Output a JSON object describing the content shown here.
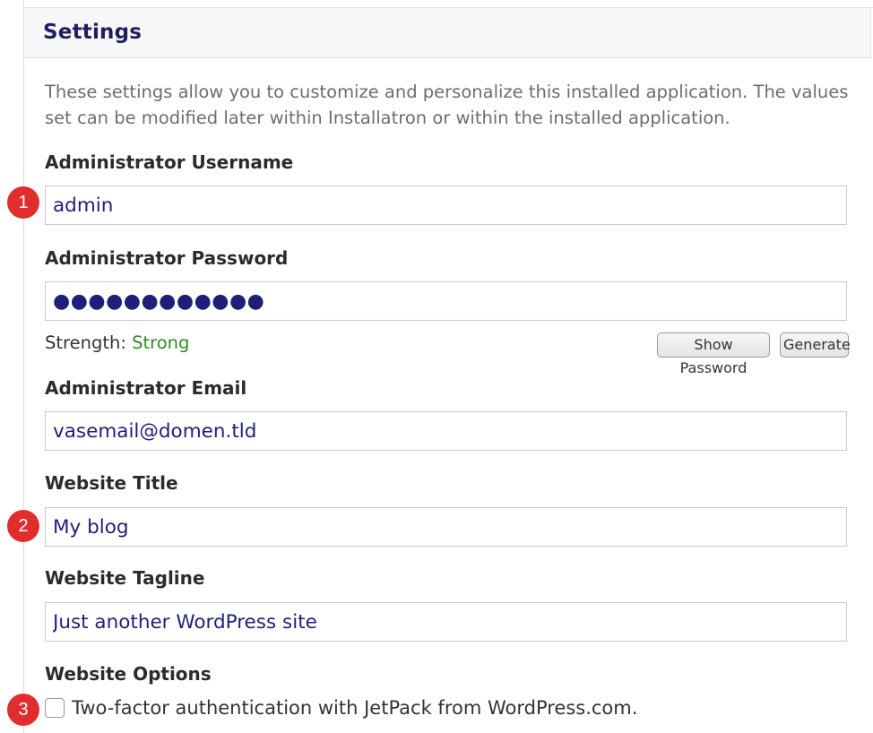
{
  "panel": {
    "title": "Settings",
    "description": "These settings allow you to customize and personalize this installed application. The values set can be modified later within Installatron or within the installed application."
  },
  "fields": {
    "admin_username": {
      "label": "Administrator Username",
      "value": "admin"
    },
    "admin_password": {
      "label": "Administrator Password",
      "value": "●●●●●●●●●●●●"
    },
    "admin_email": {
      "label": "Administrator Email",
      "value": "vasemail@domen.tld"
    },
    "website_title": {
      "label": "Website Title",
      "value": "My blog"
    },
    "website_tagline": {
      "label": "Website Tagline",
      "value": "Just another WordPress site"
    }
  },
  "password_strength": {
    "label": "Strength:",
    "value": "Strong",
    "color": "#2e8b22"
  },
  "buttons": {
    "show_password": "Show Password",
    "generate": "Generate"
  },
  "options": {
    "label": "Website Options",
    "two_factor": {
      "label": "Two-factor authentication with JetPack from WordPress.com.",
      "checked": false
    }
  },
  "badges": [
    "1",
    "2",
    "3"
  ],
  "colors": {
    "accent_badge": "#e22d2d",
    "title": "#1f1f5e",
    "input_text": "#1f1f7a"
  }
}
